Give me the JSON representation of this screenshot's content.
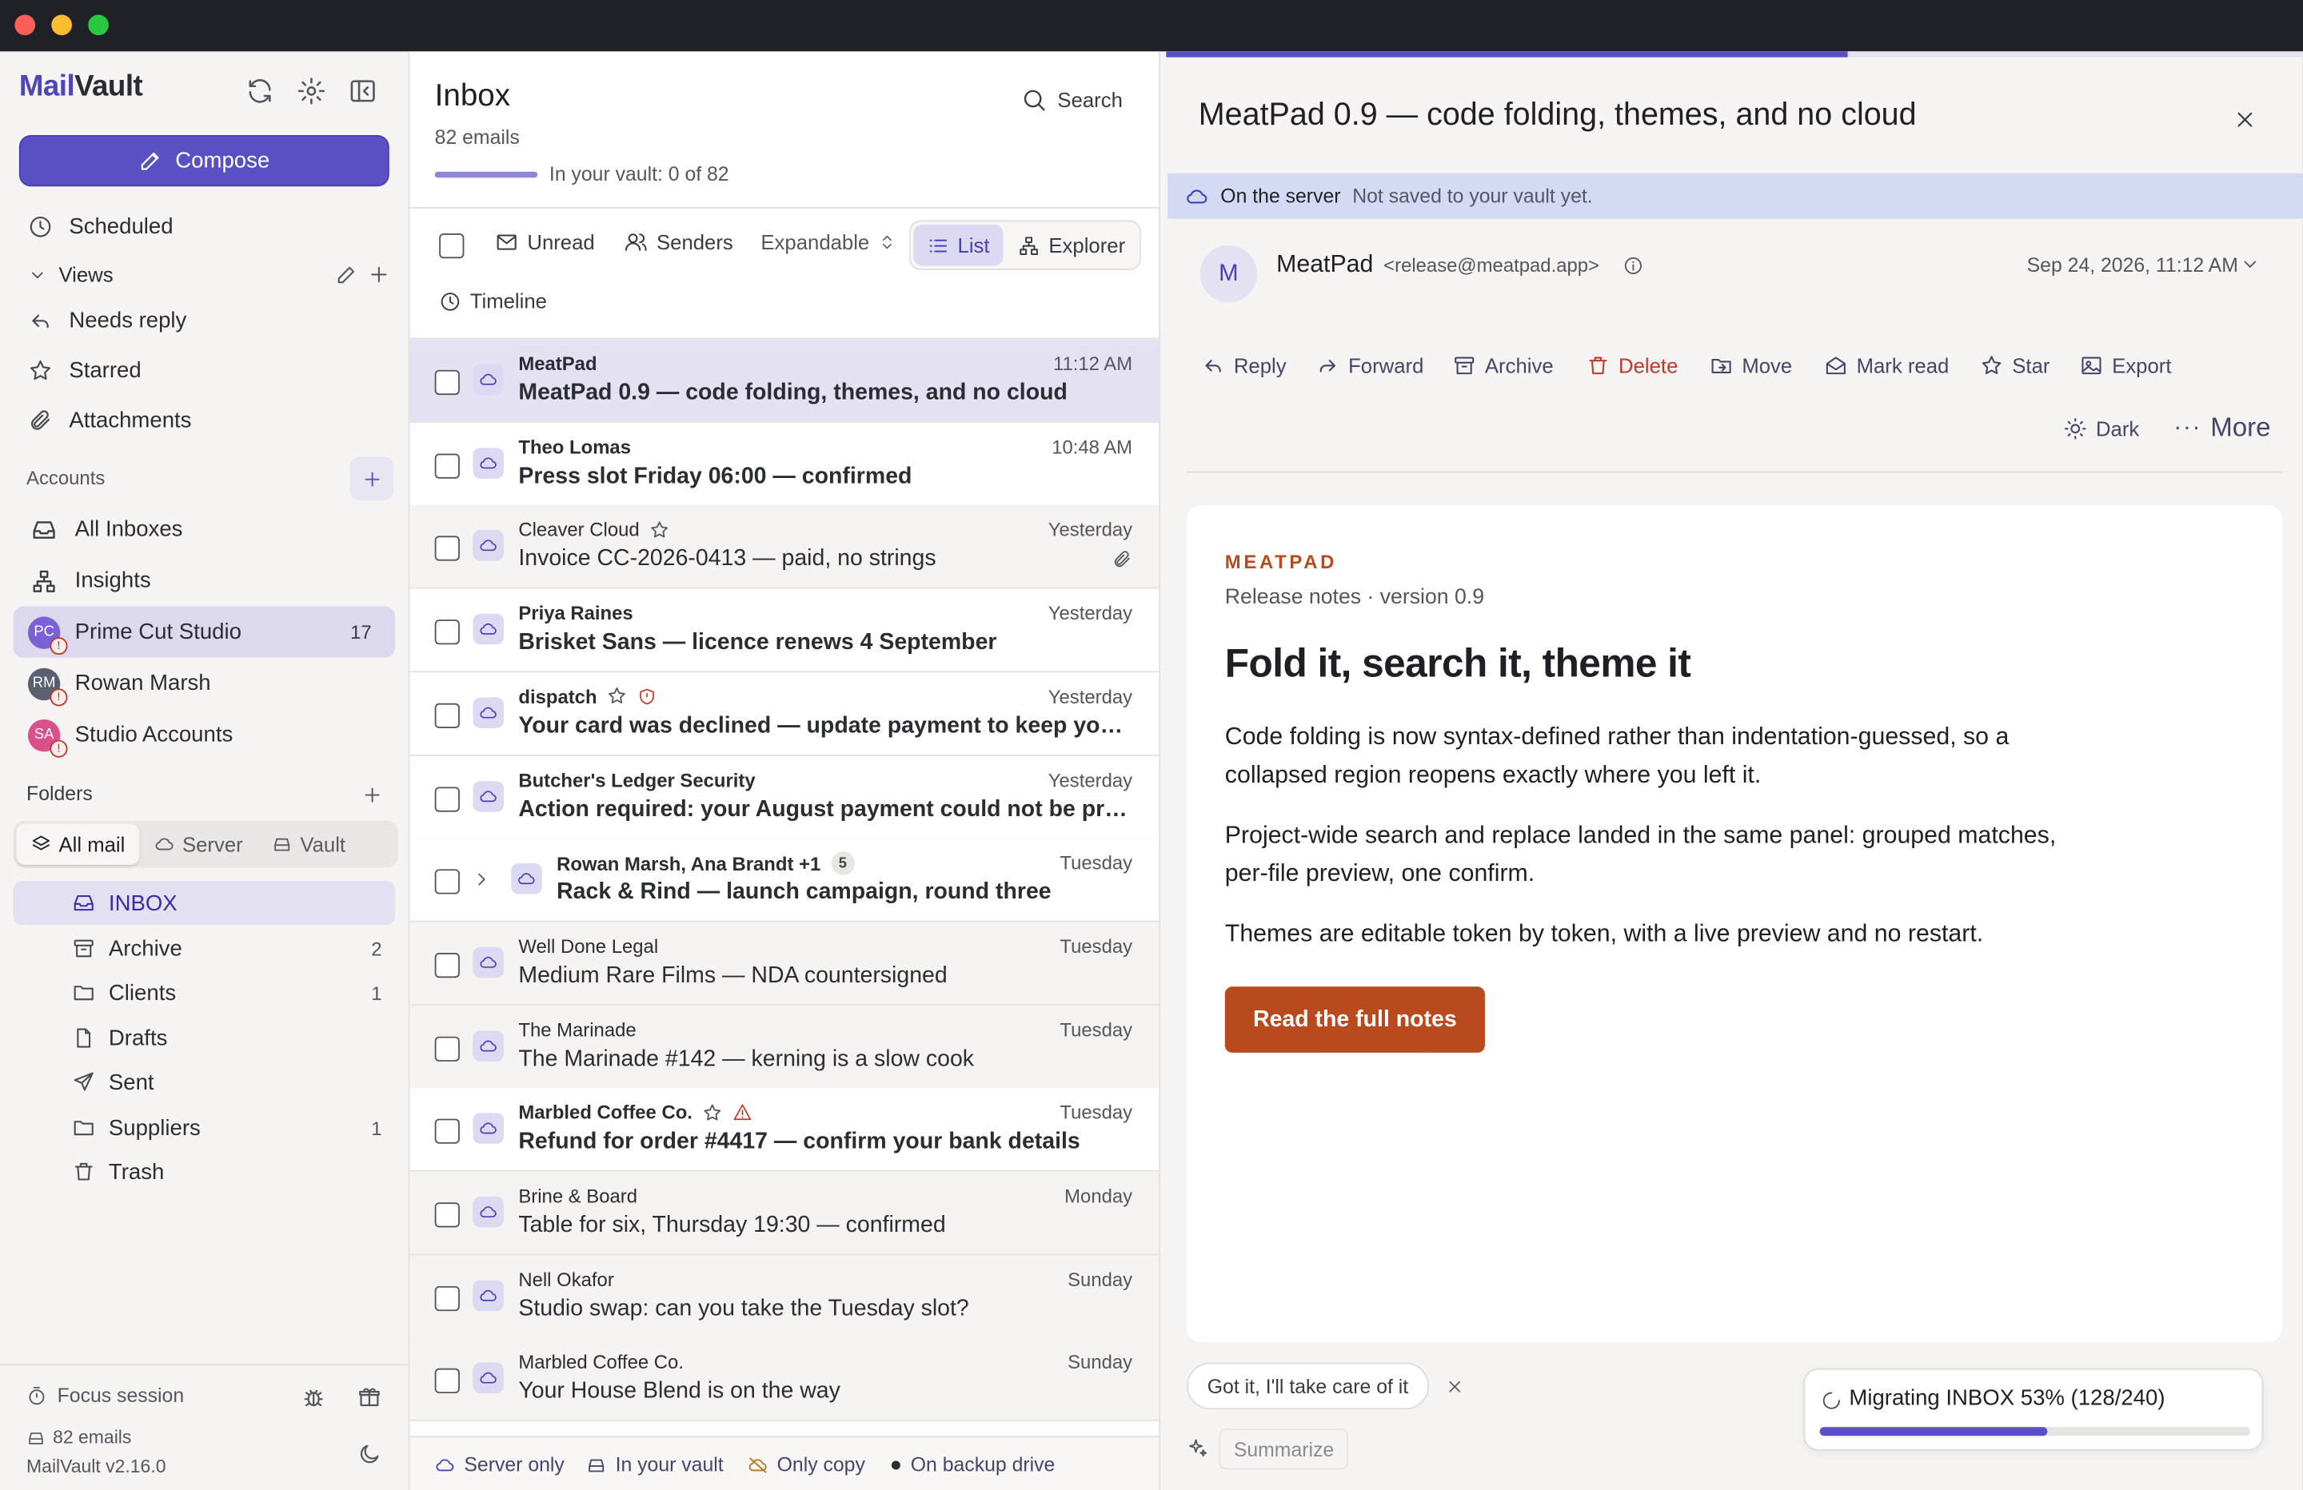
{
  "app": {
    "brand_a": "Mail",
    "brand_b": "Vault"
  },
  "sidebar": {
    "compose": "Compose",
    "top_items": [
      {
        "label": "Scheduled",
        "icon": "clock-icon"
      },
      {
        "label": "Views",
        "icon": "chevron-down-icon"
      },
      {
        "label": "Needs reply",
        "icon": "reply-icon"
      },
      {
        "label": "Starred",
        "icon": "star-icon"
      },
      {
        "label": "Attachments",
        "icon": "paperclip-icon"
      }
    ],
    "accounts_title": "Accounts",
    "accounts": [
      {
        "label": "All Inboxes",
        "icon": "inbox-icon"
      },
      {
        "label": "Insights",
        "icon": "sitemap-icon"
      },
      {
        "label": "Prime Cut Studio",
        "initials": "PC",
        "count": "17",
        "color": "#7b61d6"
      },
      {
        "label": "Rowan Marsh",
        "initials": "RM",
        "color": "#5a6070"
      },
      {
        "label": "Studio Accounts",
        "initials": "SA",
        "color": "#d9508a"
      }
    ],
    "folders_title": "Folders",
    "segments": [
      "All mail",
      "Server",
      "Vault"
    ],
    "folders": [
      {
        "label": "INBOX",
        "count": "",
        "icon": "inbox-icon"
      },
      {
        "label": "Archive",
        "count": "2",
        "icon": "archive-icon"
      },
      {
        "label": "Clients",
        "count": "1",
        "icon": "folder-icon"
      },
      {
        "label": "Drafts",
        "count": "",
        "icon": "file-icon"
      },
      {
        "label": "Sent",
        "count": "",
        "icon": "send-icon"
      },
      {
        "label": "Suppliers",
        "count": "1",
        "icon": "folder-icon"
      },
      {
        "label": "Trash",
        "count": "",
        "icon": "trash-icon"
      }
    ],
    "focus": "Focus session",
    "emails": "82 emails",
    "version": "MailVault v2.16.0"
  },
  "list": {
    "title": "Inbox",
    "count": "82 emails",
    "search": "Search",
    "vault_progress": "In your vault: 0 of 82",
    "vault_fraction": 0,
    "filters": {
      "unread": "Unread",
      "senders": "Senders",
      "expandable": "Expandable",
      "list": "List",
      "explorer": "Explorer",
      "timeline": "Timeline"
    },
    "legend": {
      "server": "Server only",
      "vault": "In your vault",
      "only": "Only copy",
      "backup": "On backup drive"
    },
    "rows": [
      {
        "from": "MeatPad",
        "subject": "MeatPad 0.9 — code folding, themes, and no cloud",
        "time": "11:12 AM",
        "state": "sel"
      },
      {
        "from": "Theo Lomas",
        "subject": "Press slot Friday 06:00 — confirmed",
        "time": "10:48 AM",
        "state": "unread"
      },
      {
        "from": "Cleaver Cloud",
        "subject": "Invoice CC-2026-0413 — paid, no strings",
        "time": "Yesterday",
        "state": "read",
        "star": true,
        "clip": true
      },
      {
        "from": "Priya Raines",
        "subject": "Brisket Sans — licence renews 4 September",
        "time": "Yesterday",
        "state": "unread"
      },
      {
        "from": "dispatch",
        "subject": "Your card was declined — update payment to keep your o…",
        "time": "Yesterday",
        "state": "unread",
        "star": true,
        "shield": true
      },
      {
        "from": "Butcher's Ledger Security",
        "subject": "Action required: your August payment could not be proc…",
        "time": "Yesterday",
        "state": "unread"
      },
      {
        "from": "Rowan Marsh, Ana Brandt +1",
        "subject": "Rack & Rind — launch campaign, round three",
        "time": "Tuesday",
        "state": "unread",
        "thread": "5"
      },
      {
        "from": "Well Done Legal",
        "subject": "Medium Rare Films — NDA countersigned",
        "time": "Tuesday",
        "state": "read"
      },
      {
        "from": "The Marinade",
        "subject": "The Marinade #142 — kerning is a slow cook",
        "time": "Tuesday",
        "state": "read"
      },
      {
        "from": "Marbled Coffee Co.",
        "subject": "Refund for order #4417 — confirm your bank details",
        "time": "Tuesday",
        "state": "unread",
        "star": true,
        "warn": true
      },
      {
        "from": "Brine & Board",
        "subject": "Table for six, Thursday 19:30 — confirmed",
        "time": "Monday",
        "state": "read"
      },
      {
        "from": "Nell Okafor",
        "subject": "Studio swap: can you take the Tuesday slot?",
        "time": "Sunday",
        "state": "read"
      },
      {
        "from": "Marbled Coffee Co.",
        "subject": "Your House Blend is on the way",
        "time": "Sunday",
        "state": "read"
      }
    ]
  },
  "reader": {
    "subject": "MeatPad 0.9 — code folding, themes, and no cloud",
    "banner_strong": "On the server",
    "banner_text": "Not saved to your vault yet.",
    "sender_initial": "M",
    "sender_name": "MeatPad",
    "sender_email": "<release@meatpad.app>",
    "date": "Sep 24, 2026, 11:12 AM",
    "actions": [
      "Reply",
      "Forward",
      "Archive",
      "Delete",
      "Move",
      "Mark read",
      "Star",
      "Export"
    ],
    "dark": "Dark",
    "more": "More",
    "email": {
      "brand": "MEATPAD",
      "sub": "Release notes · version 0.9",
      "headline": "Fold it, search it, theme it",
      "p1": "Code folding is now syntax-defined rather than indentation-guessed, so a collapsed region reopens exactly where you left it.",
      "p2": "Project-wide search and replace landed in the same panel: grouped matches, per-file preview, one confirm.",
      "p3": "Themes are editable token by token, with a live preview and no restart.",
      "cta": "Read the full notes"
    },
    "quick_reply": "Got it, I'll take care of it",
    "summarize": "Summarize",
    "migration": "Migrating INBOX 53% (128/240)",
    "migration_fraction": 0.53,
    "top_progress_fraction": 0.6
  },
  "colors": {
    "accent": "#5b4fc4",
    "cta": "#b84a1e",
    "brand_email": "#b84a1e"
  }
}
